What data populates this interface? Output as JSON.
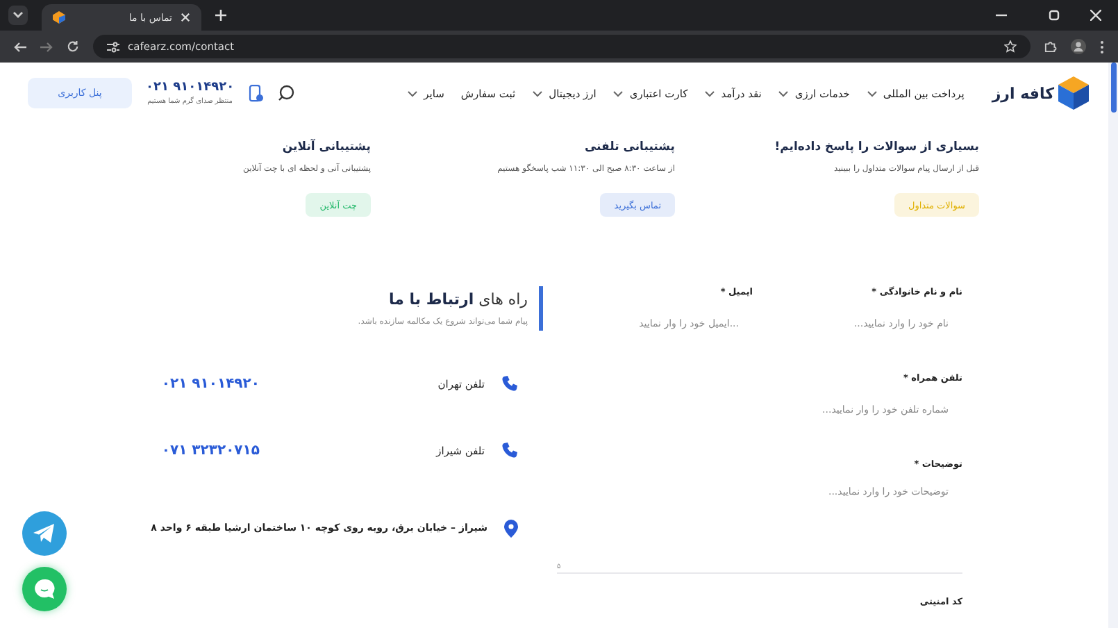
{
  "browser": {
    "tab_title": "تماس با ما",
    "url": "cafearz.com/contact"
  },
  "header": {
    "logo": "کافه ارز",
    "nav": [
      {
        "label": "پرداخت بین المللی",
        "dropdown": true
      },
      {
        "label": "خدمات ارزی",
        "dropdown": true
      },
      {
        "label": "نقد درآمد",
        "dropdown": true
      },
      {
        "label": "کارت اعتباری",
        "dropdown": true
      },
      {
        "label": "ارز دیجیتال",
        "dropdown": true
      },
      {
        "label": "ثبت سفارش",
        "dropdown": false
      },
      {
        "label": "سایر",
        "dropdown": true
      }
    ],
    "phone": "۰۲۱ ۹۱۰۱۴۹۲۰",
    "phone_note": "منتظر صدای گرم شما هستیم",
    "panel_button": "پنل کاربری"
  },
  "support_cards": [
    {
      "title": "بسیاری از سوالات را پاسخ داده‌ایم!",
      "text": "قبل از ارسال پیام سوالات متداول را ببینید",
      "button": "سوالات متداول",
      "color": "#e0b000"
    },
    {
      "title": "پشتیبانی تلفنی",
      "text": "از ساعت ۸:۳۰ صبح الی ۱۱:۳۰ شب پاسخگو هستیم",
      "button": "تماس بگیرید",
      "color": "#3b6fd8"
    },
    {
      "title": "پشتیبانی آنلاین",
      "text": "پشتیبانی آنی و لحظه ای با چت آنلاین",
      "button": "چت آنلاین",
      "color": "#22b86a"
    }
  ],
  "form": {
    "fields": [
      {
        "label": "نام و نام خانوادگی *",
        "placeholder": "نام خود را وارد نمایید...",
        "kind": "half"
      },
      {
        "label": "ایمیل *",
        "placeholder": "...ایمیل خود را وار نمایید",
        "kind": "half"
      },
      {
        "label": "تلفن همراه *",
        "placeholder": "شماره تلفن خود را وار نمایید...",
        "kind": "full"
      },
      {
        "label": "توضیحات *",
        "placeholder": "توضیحات خود را وارد نمایید...",
        "kind": "area",
        "counter": "۵"
      },
      {
        "label": "کد امنیتی",
        "kind": "label"
      }
    ]
  },
  "contact": {
    "heading": "راه های **ارتباط با ما**",
    "subtitle": "پیام شما می‌تواند شروع یک مکالمه سازنده باشد.",
    "items": [
      {
        "kind": "phone",
        "label": "تلفن تهران",
        "value": "۰۲۱ ۹۱۰۱۴۹۲۰"
      },
      {
        "kind": "phone",
        "label": "تلفن شیراز",
        "value": "۰۷۱ ۳۲۳۲۰۷۱۵"
      },
      {
        "kind": "address",
        "label": "شیراز",
        "value": "–  خیابان برق، روبه روی کوچه ۱۰ ساختمان ارشیا طبقه ۶ واحد ۸"
      }
    ]
  }
}
